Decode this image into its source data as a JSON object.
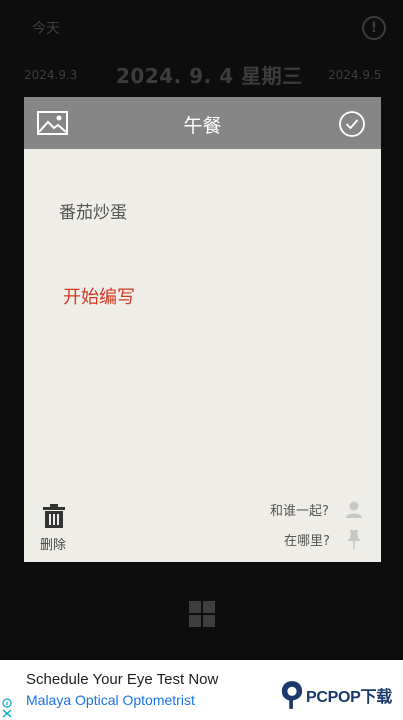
{
  "header": {
    "today_label": "今天",
    "info_icon": "info-icon"
  },
  "dates": {
    "previous": "2024.9.3",
    "current": "2024. 9. 4 星期三",
    "next": "2024.9.5"
  },
  "dialog": {
    "title": "午餐",
    "left_icon": "image-icon",
    "right_icon": "check-icon",
    "note_text": "番茄炒蛋",
    "start_writing": "开始编写",
    "delete_label": "删除",
    "with_who_label": "和谁一起?",
    "where_label": "在哪里?",
    "colors": {
      "header_bg": "#868686",
      "body_bg": "#efede7",
      "accent": "#d03a22"
    }
  },
  "bottom_nav": {
    "icon": "grid-icon"
  },
  "ad": {
    "title": "Schedule Your Eye Test Now",
    "subtitle": "Malaya Optical Optometrist",
    "logo_text": "PCPOP下载"
  }
}
